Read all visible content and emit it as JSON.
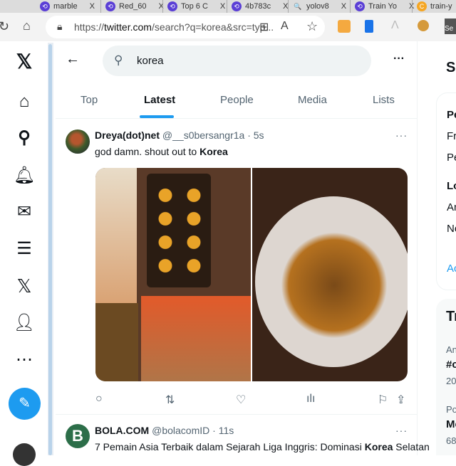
{
  "browser": {
    "tabs": [
      {
        "label": "marble"
      },
      {
        "label": "Red_60"
      },
      {
        "label": "Top 6 C"
      },
      {
        "label": "4b783c"
      },
      {
        "label": "yolov8"
      },
      {
        "label": "Train Yo"
      },
      {
        "label": "train-y"
      }
    ],
    "url_prefix": "https://",
    "url_domain": "twitter.com",
    "url_rest": "/search?q=korea&src=typ..."
  },
  "nav": {
    "items": [
      "logo",
      "home",
      "explore",
      "notifications",
      "messages",
      "lists",
      "premium",
      "profile",
      "more"
    ],
    "compose": "post"
  },
  "search": {
    "query": "korea",
    "back": "←",
    "more": "···"
  },
  "tabs": [
    {
      "label": "Top"
    },
    {
      "label": "Latest",
      "active": true
    },
    {
      "label": "People"
    },
    {
      "label": "Media"
    },
    {
      "label": "Lists"
    }
  ],
  "tweets": [
    {
      "name": "Dreya(dot)net",
      "handle": "@__s0bersangr1a",
      "time": "· 5s",
      "text": "god damn. shout out to ",
      "bold": "Korea",
      "after": ""
    },
    {
      "name": "BOLA.COM",
      "handle": "@bolacomID",
      "time": "· 11s",
      "text": "7 Pemain Asia Terbaik dalam Sejarah Liga Inggris: Dominasi ",
      "bold": "Korea",
      "after": " Selatan"
    }
  ],
  "right": {
    "search_label": "Se",
    "filters": [
      "Pe",
      "Fro",
      "Pe",
      "Lo",
      "An",
      "Ne",
      "Ac"
    ],
    "trends": [
      "Tr",
      "An",
      "#c",
      "20",
      "Po",
      "Me",
      "68"
    ]
  },
  "colors": {
    "accent": "#1d9bf0"
  }
}
